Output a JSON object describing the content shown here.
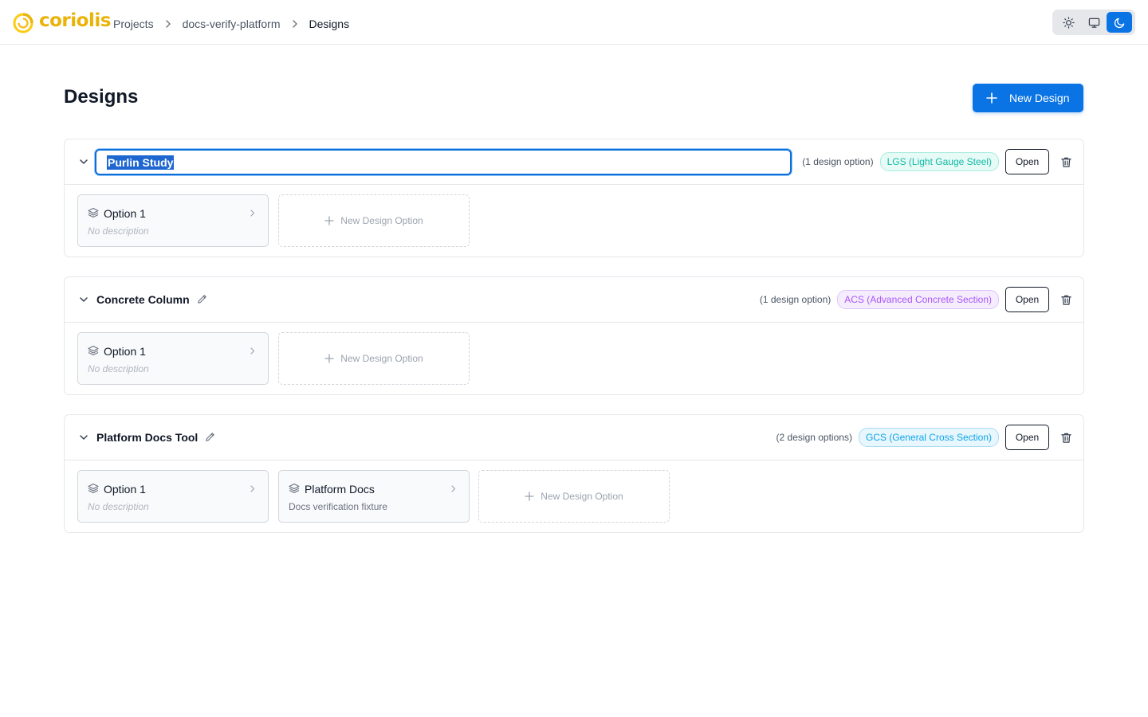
{
  "brand": {
    "name": "coriolis",
    "color": "#eab308"
  },
  "breadcrumb": [
    "Projects",
    "docs-verify-platform",
    "Designs"
  ],
  "theme": {
    "options": [
      "light",
      "system",
      "dark"
    ],
    "selected": "dark"
  },
  "page": {
    "title": "Designs",
    "new_design_label": "New Design"
  },
  "designs": [
    {
      "name": "Purlin Study",
      "editing": true,
      "count_label": "(1 design option)",
      "badge": "LGS (Light Gauge Steel)",
      "open_label": "Open",
      "options": [
        {
          "name": "Option 1",
          "description": "No description"
        }
      ],
      "new_option_label": "New Design Option"
    },
    {
      "name": "Concrete Column",
      "editing": false,
      "count_label": "(1 design option)",
      "badge": "ACS (Advanced Concrete Section)",
      "open_label": "Open",
      "options": [
        {
          "name": "Option 1",
          "description": "No description"
        }
      ],
      "new_option_label": "New Design Option"
    },
    {
      "name": "Platform Docs Tool",
      "editing": false,
      "count_label": "(2 design options)",
      "badge": "GCS (General Cross Section)",
      "open_label": "Open",
      "options": [
        {
          "name": "Option 1",
          "description": "No description"
        },
        {
          "name": "Platform Docs",
          "description": "Docs verification fixture"
        }
      ],
      "new_option_label": "New Design Option"
    }
  ]
}
